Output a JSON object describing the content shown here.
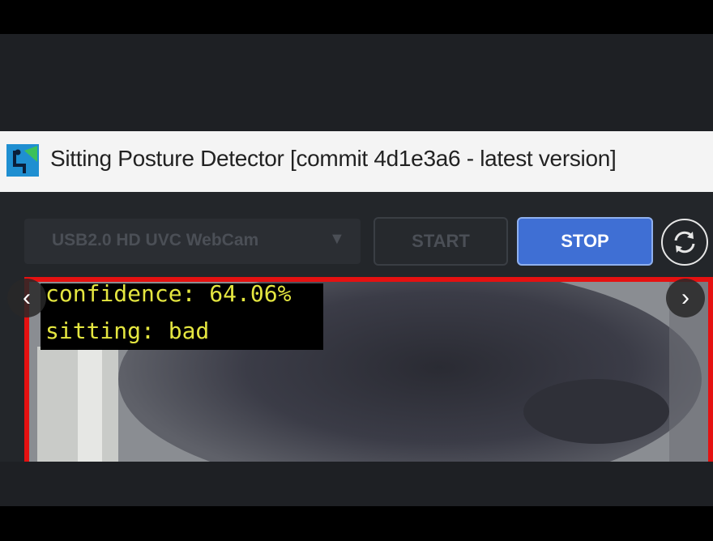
{
  "window": {
    "title": "Sitting Posture Detector [commit 4d1e3a6 - latest version]",
    "icon": "posture-app-icon"
  },
  "toolbar": {
    "camera_select_value": "USB2.0 HD UVC WebCam",
    "camera_select_arrow": "▼",
    "start_label": "START",
    "stop_label": "STOP",
    "refresh_icon": "refresh-icon"
  },
  "video": {
    "confidence_text": "confidence: 64.06%",
    "status_text": "sitting: bad",
    "frame_color": "#e51111",
    "overlay_text_color": "#e4e640"
  },
  "gallery": {
    "prev_glyph": "‹",
    "next_glyph": "›"
  },
  "colors": {
    "accent": "#3f6fd4",
    "toolbar_bg": "#23262a",
    "title_bar_bg": "#f4f4f4"
  }
}
